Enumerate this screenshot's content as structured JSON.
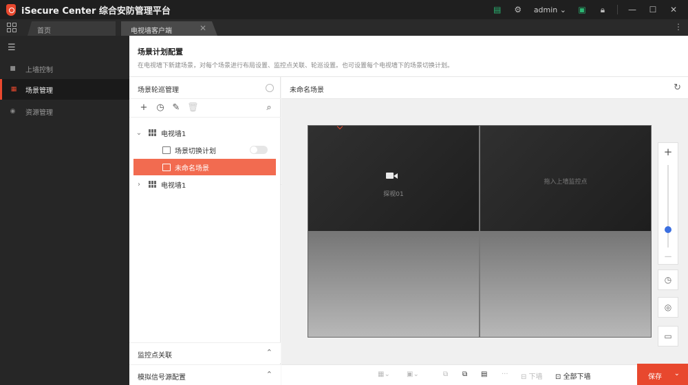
{
  "app": {
    "title": "iSecure Center 综合安防管理平台",
    "user": "admin"
  },
  "tabs": [
    {
      "label": "首页"
    },
    {
      "label": "电视墙客户端"
    }
  ],
  "nav": {
    "items": [
      {
        "label": "上墙控制",
        "icon": "monitor-icon"
      },
      {
        "label": "场景管理",
        "icon": "calendar-icon",
        "active": true
      },
      {
        "label": "资源管理",
        "icon": "resource-icon"
      }
    ]
  },
  "page": {
    "title": "场景计划配置",
    "description": "在电视墙下新建场景，对每个场景进行布局设置、监控点关联、轮巡设置。也可设置每个电视墙下的场景切换计划。"
  },
  "left_panel": {
    "title": "场景轮巡管理",
    "tree": [
      {
        "label": "电视墙1",
        "expanded": true
      },
      {
        "label": "场景切换计划",
        "toggle": false
      },
      {
        "label": "未命名场景",
        "selected": true
      },
      {
        "label": "电视墙1",
        "expanded": false
      }
    ],
    "accordions": [
      {
        "label": "监控点关联"
      },
      {
        "label": "模拟信号源配置"
      }
    ]
  },
  "scene": {
    "name": "未命名场景",
    "cells": [
      {
        "type": "camera",
        "label": "探视01"
      },
      {
        "type": "hint",
        "label": "拖入上墙监控点"
      },
      {
        "type": "empty"
      },
      {
        "type": "empty"
      }
    ],
    "zoom_level": 0.22
  },
  "bottom": {
    "down_wall": "下墙",
    "all_down_wall": "全部下墙",
    "save": "保存"
  },
  "colors": {
    "accent": "#e8482e",
    "selected_row": "#f26b50",
    "zoom_thumb": "#3b6fe0"
  }
}
